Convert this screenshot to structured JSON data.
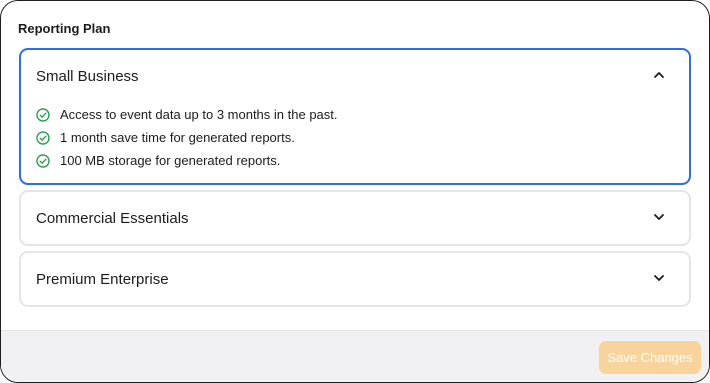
{
  "section_title": "Reporting Plan",
  "plans": [
    {
      "name": "Small Business",
      "expanded": true,
      "features": [
        "Access to event data up to 3 months in the past.",
        "1 month save time for generated reports.",
        "100 MB storage for generated reports."
      ]
    },
    {
      "name": "Commercial Essentials",
      "expanded": false
    },
    {
      "name": "Premium Enterprise",
      "expanded": false
    }
  ],
  "footer": {
    "save_label": "Save Changes",
    "save_enabled": false
  },
  "colors": {
    "accent_border": "#2f6fe0",
    "check": "#2e9e4f",
    "save_button_bg": "#f8d49c",
    "footer_bg": "#f1f1f3"
  },
  "icons": {
    "feature": "check-circle-icon",
    "expanded": "chevron-up-icon",
    "collapsed": "chevron-down-icon"
  }
}
